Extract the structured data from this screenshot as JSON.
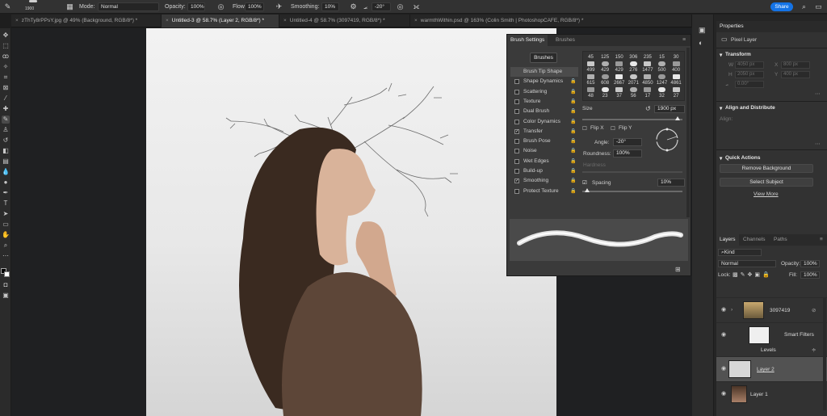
{
  "options_bar": {
    "brush_size": "1900",
    "mode_label": "Mode:",
    "mode_value": "Normal",
    "opacity_label": "Opacity:",
    "opacity_value": "100%",
    "flow_label": "Flow:",
    "flow_value": "100%",
    "smoothing_label": "Smoothing:",
    "smoothing_value": "10%",
    "angle_value": "-20°",
    "share_label": "Share"
  },
  "tabs": [
    {
      "label": "zThTy8rPPsY.jpg @ 49% (Background, RGB/8*) *",
      "active": false
    },
    {
      "label": "Untitled-3 @ 58.7% (Layer 2, RGB/8*) *",
      "active": true
    },
    {
      "label": "Untitled-4 @ 58.7% (3097419, RGB/8*) *",
      "active": false
    },
    {
      "label": "warmthWithin.psd @ 163% (Colin Smith | PhotoshopCAFE, RGB/8*) *",
      "active": false
    }
  ],
  "brush_panel": {
    "tab_brush_settings": "Brush Settings",
    "tab_brushes": "Brushes",
    "brushes_button": "Brushes",
    "options": [
      {
        "label": "Brush Tip Shape",
        "checked": null,
        "selected": true
      },
      {
        "label": "Shape Dynamics",
        "checked": false
      },
      {
        "label": "Scattering",
        "checked": false
      },
      {
        "label": "Texture",
        "checked": false
      },
      {
        "label": "Dual Brush",
        "checked": false
      },
      {
        "label": "Color Dynamics",
        "checked": false
      },
      {
        "label": "Transfer",
        "checked": true
      },
      {
        "label": "Brush Pose",
        "checked": false
      },
      {
        "label": "Noise",
        "checked": false
      },
      {
        "label": "Wet Edges",
        "checked": false
      },
      {
        "label": "Build-up",
        "checked": false
      },
      {
        "label": "Smoothing",
        "checked": true
      },
      {
        "label": "Protect Texture",
        "checked": false
      }
    ],
    "tip_sizes": [
      [
        "45",
        "125",
        "150",
        "306",
        "235",
        "15",
        "30"
      ],
      [
        "499",
        "429",
        "429",
        "276",
        "1477",
        "500",
        "400"
      ],
      [
        "615",
        "608",
        "2667",
        "2071",
        "4850",
        "1247",
        "4861"
      ],
      [
        "48",
        "23",
        "37",
        "56",
        "17",
        "32",
        "27"
      ]
    ],
    "size_label": "Size",
    "size_value": "1900 px",
    "flip_x_label": "Flip X",
    "flip_y_label": "Flip Y",
    "angle_label": "Angle:",
    "angle_value": "-20°",
    "roundness_label": "Roundness:",
    "roundness_value": "100%",
    "hardness_label": "Hardness",
    "spacing_label": "Spacing",
    "spacing_value": "10%"
  },
  "properties": {
    "title": "Properties",
    "layer_type": "Pixel Layer",
    "transform_label": "Transform",
    "w_label": "W",
    "h_label": "H",
    "x_label": "X",
    "y_label": "Y",
    "w_value": "4050 px",
    "h_value": "2050 px",
    "x_value": "800 px",
    "y_value": "400 px",
    "angle_value": "0.00°",
    "align_label": "Align and Distribute",
    "align_sub": "Align:",
    "quick_actions_label": "Quick Actions",
    "remove_bg": "Remove Background",
    "select_subject": "Select Subject",
    "view_more": "View More"
  },
  "layers": {
    "tab_layers": "Layers",
    "tab_channels": "Channels",
    "tab_paths": "Paths",
    "kind_value": "Kind",
    "blend_mode": "Normal",
    "opacity_label": "Opacity:",
    "opacity_value": "100%",
    "lock_label": "Lock:",
    "fill_label": "Fill:",
    "fill_value": "100%",
    "rows": [
      {
        "name": "3097419",
        "type": "smart"
      },
      {
        "name": "Smart Filters",
        "type": "filter"
      },
      {
        "name": "Levels",
        "type": "sub"
      },
      {
        "name": "Layer 2",
        "type": "pixel",
        "selected": true
      },
      {
        "name": "Layer 1",
        "type": "photo"
      }
    ]
  }
}
